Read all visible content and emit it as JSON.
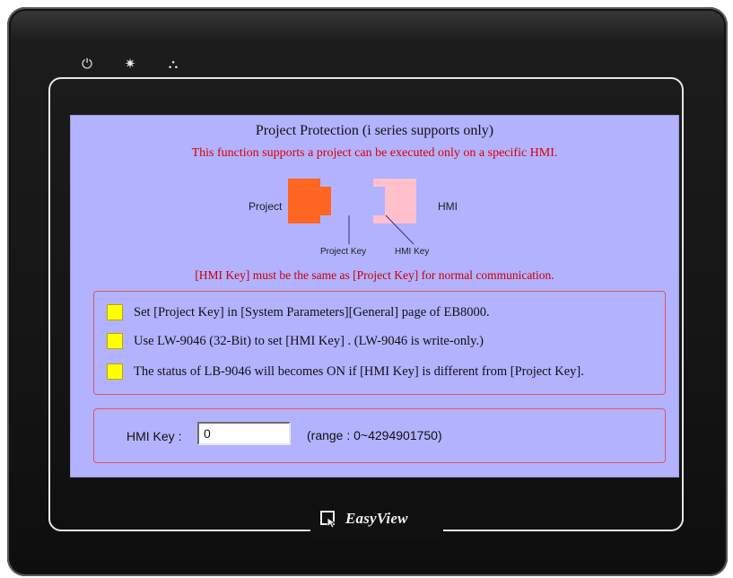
{
  "device": {
    "indicators": [
      "power-icon",
      "sun-icon",
      "network-icon"
    ],
    "brand": "EasyView"
  },
  "screen": {
    "title": "Project Protection (i series supports only)",
    "subtitle": "This function supports a project can be executed only on a specific HMI.",
    "diagram": {
      "project_label": "Project",
      "hmi_label": "HMI",
      "project_key_label": "Project Key",
      "hmi_key_label": "HMI Key",
      "project_color": "#ff6622",
      "hmi_color": "#ffc0cc"
    },
    "note": "[HMI Key] must be the same as [Project Key] for normal communication.",
    "steps": [
      "Set [Project Key] in [System Parameters][General] page of EB8000.",
      "Use LW-9046 (32-Bit) to set [HMI Key] . (LW-9046 is write-only.)",
      "The status of LB-9046 will becomes ON if [HMI Key] is different from [Project Key]."
    ],
    "hmi_key": {
      "label": "HMI Key :",
      "value": "0",
      "range": "(range : 0~4294901750)"
    },
    "colors": {
      "background": "#b2b2ff",
      "accent_red": "#d90000",
      "marker_yellow": "#ffff00"
    }
  }
}
